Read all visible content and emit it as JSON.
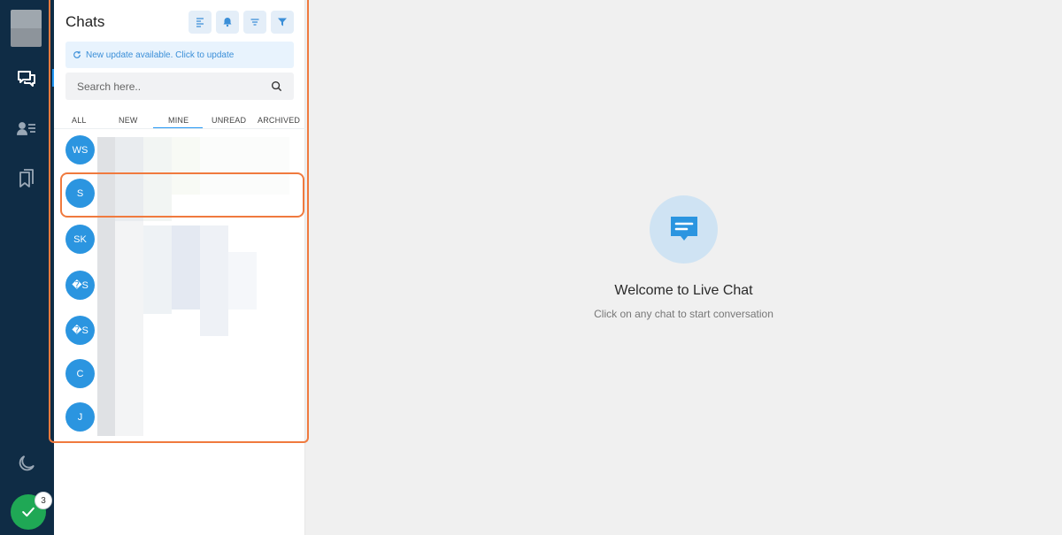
{
  "rail": {
    "icons": [
      "chat-icon",
      "contacts-icon",
      "bookmarks-icon",
      "moon-icon",
      "check-icon"
    ],
    "notification_count": "3",
    "accent_color": "#2196f3",
    "status_color": "#1fa855"
  },
  "panel": {
    "title": "Chats",
    "toolbar_icons": [
      "align-left-icon",
      "bell-icon",
      "sort-icon",
      "filter-icon"
    ],
    "update_text": "New update available. Click to update",
    "search_placeholder": "Search here..",
    "tabs": [
      {
        "label": "ALL"
      },
      {
        "label": "NEW"
      },
      {
        "label": "MINE"
      },
      {
        "label": "UNREAD"
      },
      {
        "label": "ARCHIVED"
      }
    ],
    "active_tab": "MINE",
    "chats": [
      {
        "initials": "WS"
      },
      {
        "initials": "S"
      },
      {
        "initials": "SK"
      },
      {
        "initials": "�S"
      },
      {
        "initials": "�S"
      },
      {
        "initials": "C"
      },
      {
        "initials": "J"
      }
    ]
  },
  "main": {
    "welcome_title": "Welcome to Live Chat",
    "welcome_subtitle": "Click on any chat to start conversation",
    "icon": "chat-bubble-icon"
  }
}
